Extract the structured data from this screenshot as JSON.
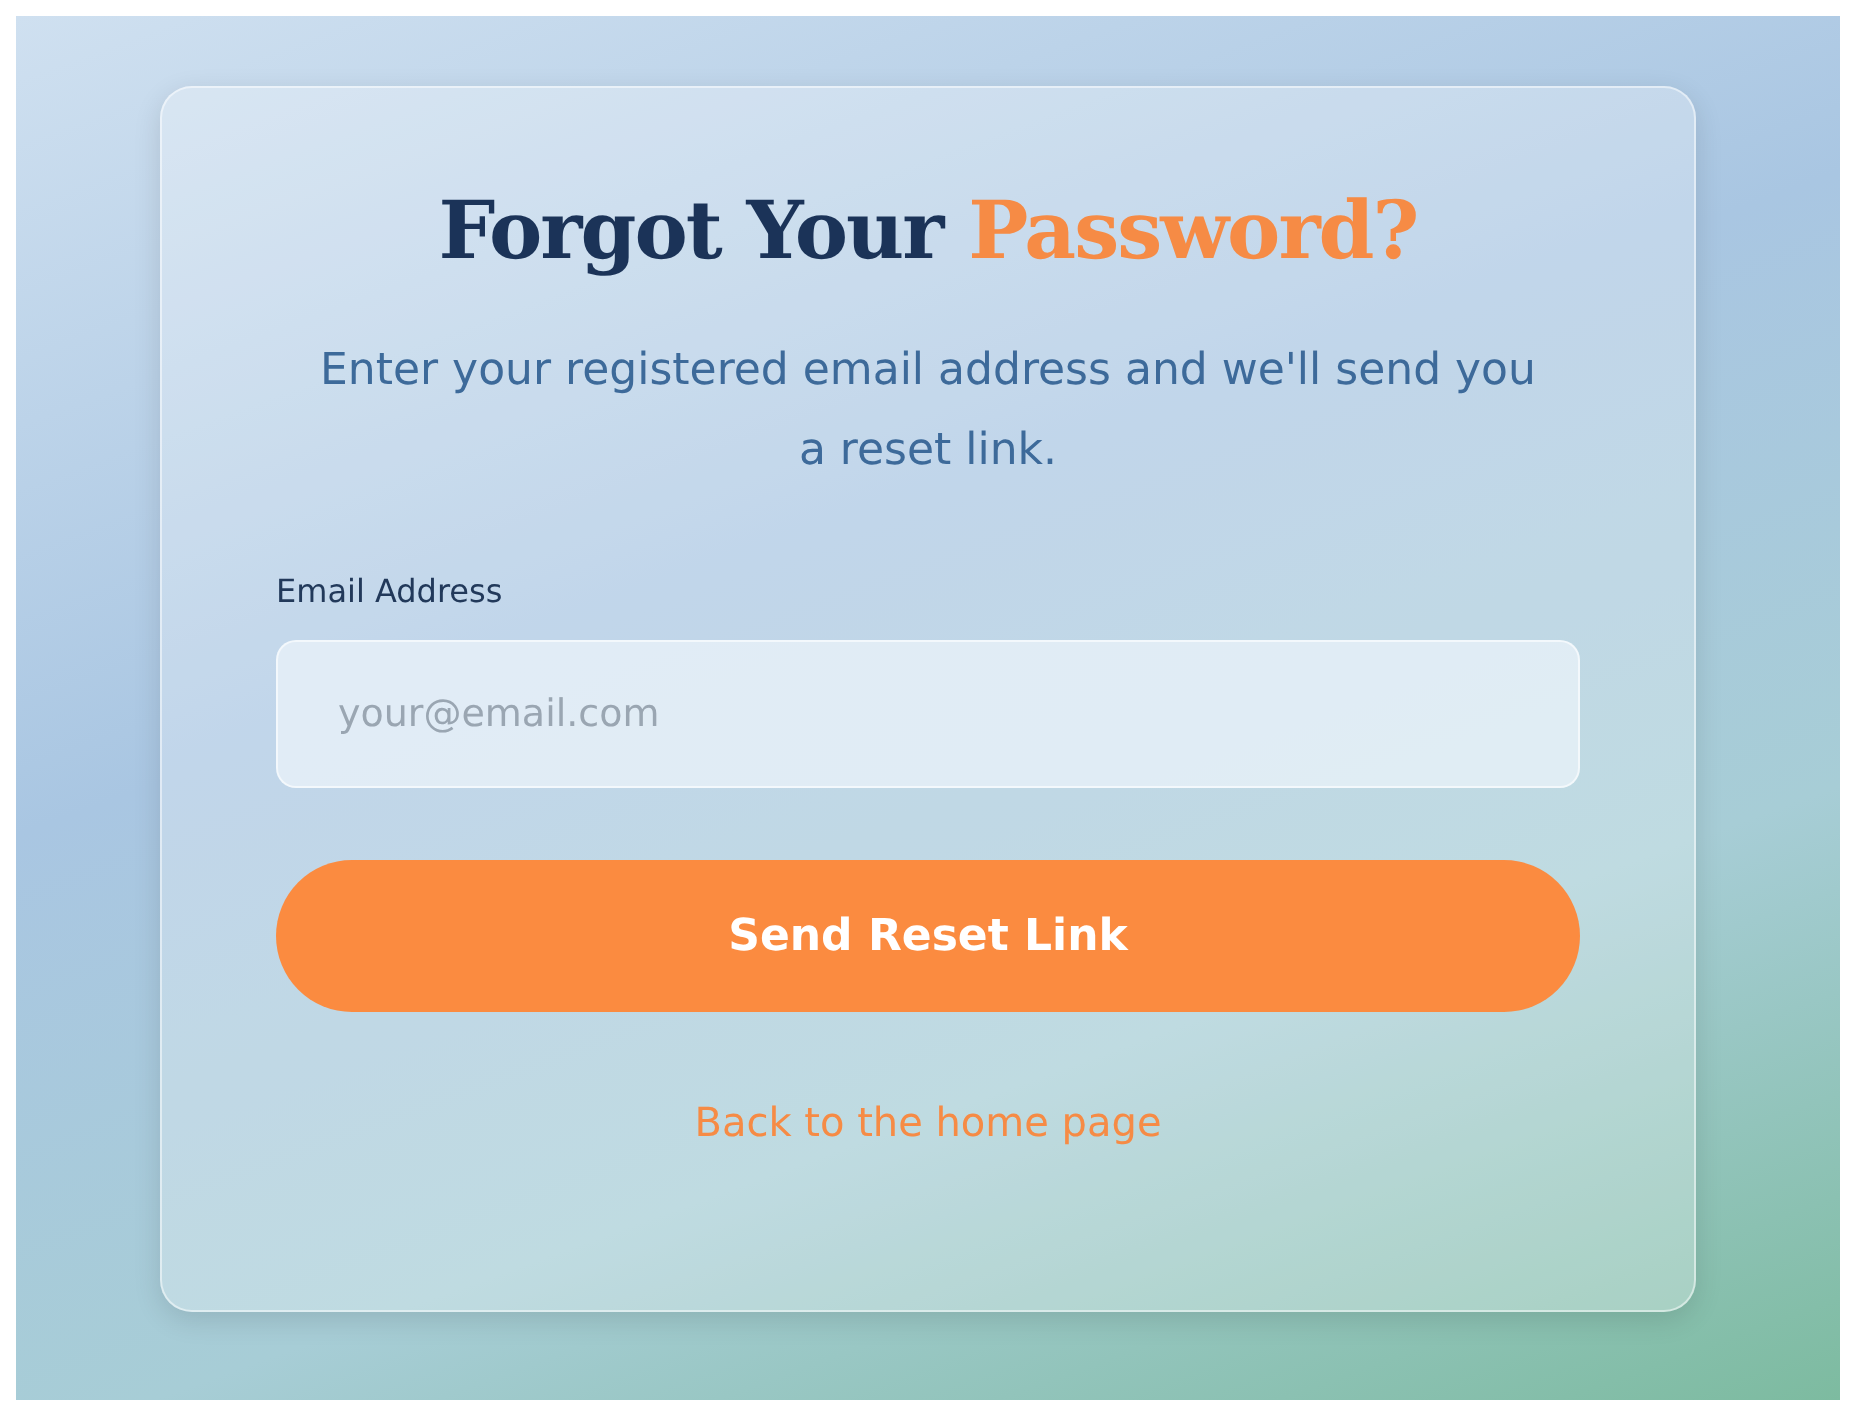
{
  "title": {
    "text": "Forgot Your",
    "highlight": "Password?"
  },
  "subtitle": "Enter your registered email address and we'll send you a reset link.",
  "email_field": {
    "label": "Email Address",
    "placeholder": "your@email.com"
  },
  "submit_button": "Send Reset Link",
  "back_link": "Back to the home page"
}
